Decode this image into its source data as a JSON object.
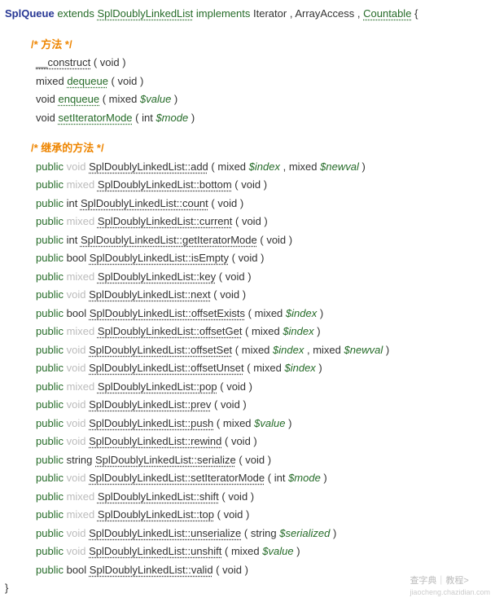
{
  "header": {
    "className": "SplQueue",
    "extends": "extends",
    "parentClass": "SplDoublyLinkedList",
    "implements": "implements",
    "interfaces": [
      "Iterator",
      "ArrayAccess",
      "Countable"
    ]
  },
  "sections": {
    "methods": "/* 方法 */",
    "inherited": "/* 继承的方法 */"
  },
  "ownMethods": [
    {
      "return": "",
      "name": "__construct",
      "params": "void",
      "linkClass": "link-dark"
    },
    {
      "return": "mixed",
      "name": "dequeue",
      "params": "void",
      "linkClass": "link"
    },
    {
      "return": "void",
      "name": "enqueue",
      "params": [
        {
          "type": "mixed",
          "name": "$value"
        }
      ],
      "linkClass": "link"
    },
    {
      "return": "void",
      "name": "setIteratorMode",
      "params": [
        {
          "type": "int",
          "name": "$mode"
        }
      ],
      "linkClass": "link"
    }
  ],
  "inheritedMethods": [
    {
      "vis": "public",
      "ret": "void",
      "retFaded": true,
      "name": "SplDoublyLinkedList::add",
      "params": [
        {
          "type": "mixed",
          "name": "$index"
        },
        {
          "type": "mixed",
          "name": "$newval"
        }
      ]
    },
    {
      "vis": "public",
      "ret": "mixed",
      "retFaded": true,
      "name": "SplDoublyLinkedList::bottom",
      "params": "void"
    },
    {
      "vis": "public",
      "ret": "int",
      "retFaded": false,
      "name": "SplDoublyLinkedList::count",
      "params": "void"
    },
    {
      "vis": "public",
      "ret": "mixed",
      "retFaded": true,
      "name": "SplDoublyLinkedList::current",
      "params": "void"
    },
    {
      "vis": "public",
      "ret": "int",
      "retFaded": false,
      "name": "SplDoublyLinkedList::getIteratorMode",
      "params": "void"
    },
    {
      "vis": "public",
      "ret": "bool",
      "retFaded": false,
      "name": "SplDoublyLinkedList::isEmpty",
      "params": "void"
    },
    {
      "vis": "public",
      "ret": "mixed",
      "retFaded": true,
      "name": "SplDoublyLinkedList::key",
      "params": "void"
    },
    {
      "vis": "public",
      "ret": "void",
      "retFaded": true,
      "name": "SplDoublyLinkedList::next",
      "params": "void"
    },
    {
      "vis": "public",
      "ret": "bool",
      "retFaded": false,
      "name": "SplDoublyLinkedList::offsetExists",
      "params": [
        {
          "type": "mixed",
          "name": "$index"
        }
      ]
    },
    {
      "vis": "public",
      "ret": "mixed",
      "retFaded": true,
      "name": "SplDoublyLinkedList::offsetGet",
      "params": [
        {
          "type": "mixed",
          "name": "$index"
        }
      ]
    },
    {
      "vis": "public",
      "ret": "void",
      "retFaded": true,
      "name": "SplDoublyLinkedList::offsetSet",
      "params": [
        {
          "type": "mixed",
          "name": "$index"
        },
        {
          "type": "mixed",
          "name": "$newval"
        }
      ]
    },
    {
      "vis": "public",
      "ret": "void",
      "retFaded": true,
      "name": "SplDoublyLinkedList::offsetUnset",
      "params": [
        {
          "type": "mixed",
          "name": "$index"
        }
      ]
    },
    {
      "vis": "public",
      "ret": "mixed",
      "retFaded": true,
      "name": "SplDoublyLinkedList::pop",
      "params": "void"
    },
    {
      "vis": "public",
      "ret": "void",
      "retFaded": true,
      "name": "SplDoublyLinkedList::prev",
      "params": "void"
    },
    {
      "vis": "public",
      "ret": "void",
      "retFaded": true,
      "name": "SplDoublyLinkedList::push",
      "params": [
        {
          "type": "mixed",
          "name": "$value"
        }
      ]
    },
    {
      "vis": "public",
      "ret": "void",
      "retFaded": true,
      "name": "SplDoublyLinkedList::rewind",
      "params": "void"
    },
    {
      "vis": "public",
      "ret": "string",
      "retFaded": false,
      "name": "SplDoublyLinkedList::serialize",
      "params": "void"
    },
    {
      "vis": "public",
      "ret": "void",
      "retFaded": true,
      "name": "SplDoublyLinkedList::setIteratorMode",
      "params": [
        {
          "type": "int",
          "name": "$mode"
        }
      ]
    },
    {
      "vis": "public",
      "ret": "mixed",
      "retFaded": true,
      "name": "SplDoublyLinkedList::shift",
      "params": "void"
    },
    {
      "vis": "public",
      "ret": "mixed",
      "retFaded": true,
      "name": "SplDoublyLinkedList::top",
      "params": "void"
    },
    {
      "vis": "public",
      "ret": "void",
      "retFaded": true,
      "name": "SplDoublyLinkedList::unserialize",
      "params": [
        {
          "type": "string",
          "name": "$serialized"
        }
      ]
    },
    {
      "vis": "public",
      "ret": "void",
      "retFaded": true,
      "name": "SplDoublyLinkedList::unshift",
      "params": [
        {
          "type": "mixed",
          "name": "$value"
        }
      ]
    },
    {
      "vis": "public",
      "ret": "bool",
      "retFaded": false,
      "name": "SplDoublyLinkedList::valid",
      "params": "void"
    }
  ],
  "watermark": {
    "line1": "查字典｜教程>",
    "line2": "jiaocheng.chazidian.com"
  }
}
